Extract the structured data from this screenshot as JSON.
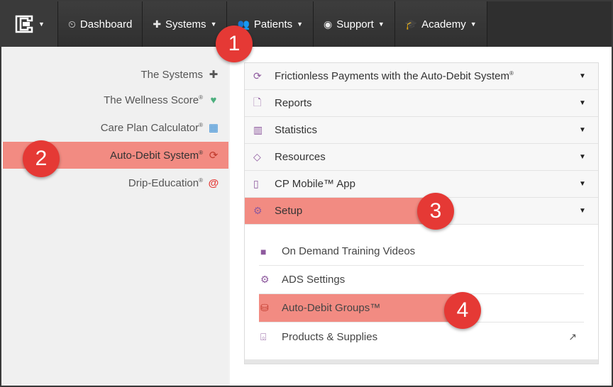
{
  "nav": {
    "logo_icon": "app-logo-icon",
    "items": [
      {
        "label": "Dashboard",
        "icon": "dashboard-icon",
        "glyph": "⏲",
        "has_caret": false
      },
      {
        "label": "Systems",
        "icon": "puzzle-icon",
        "glyph": "✚",
        "has_caret": true
      },
      {
        "label": "Patients",
        "icon": "users-icon",
        "glyph": "👥",
        "has_caret": true
      },
      {
        "label": "Support",
        "icon": "lifebuoy-icon",
        "glyph": "◉",
        "has_caret": true
      },
      {
        "label": "Academy",
        "icon": "graduation-cap-icon",
        "glyph": "🎓",
        "has_caret": true
      }
    ]
  },
  "sidebar": {
    "items": [
      {
        "label": "The Systems",
        "reg": "",
        "icon": "puzzle-icon",
        "glyph": "✚",
        "color": "#555555"
      },
      {
        "label": "The Wellness Score",
        "reg": "®",
        "icon": "heartbeat-icon",
        "glyph": "♥",
        "color": "#4caf7d"
      },
      {
        "label": "Care Plan Calculator",
        "reg": "®",
        "icon": "calculator-icon",
        "glyph": "▦",
        "color": "#3b8fd6"
      },
      {
        "label": "Auto-Debit System",
        "reg": "®",
        "icon": "refresh-icon",
        "glyph": "⟳",
        "color": "#c0392b"
      },
      {
        "label": "Drip-Education",
        "reg": "®",
        "icon": "at-icon",
        "glyph": "@",
        "color": "#e53935"
      }
    ]
  },
  "accordion": {
    "rows": [
      {
        "label": "Frictionless Payments with the Auto-Debit System",
        "reg": "®",
        "icon": "refresh-icon",
        "glyph": "⟳"
      },
      {
        "label": "Reports",
        "reg": "",
        "icon": "file-icon",
        "glyph": "🗋"
      },
      {
        "label": "Statistics",
        "reg": "",
        "icon": "bar-chart-icon",
        "glyph": "▥"
      },
      {
        "label": "Resources",
        "reg": "",
        "icon": "diamond-icon",
        "glyph": "◇"
      },
      {
        "label": "CP Mobile™ App",
        "reg": "",
        "icon": "mobile-icon",
        "glyph": "▯"
      },
      {
        "label": "Setup",
        "reg": "",
        "icon": "cogs-icon",
        "glyph": "⚙"
      }
    ],
    "setup_items": [
      {
        "label": "On Demand Training Videos",
        "icon": "video-camera-icon",
        "glyph": "■"
      },
      {
        "label": "ADS Settings",
        "icon": "gear-icon",
        "glyph": "⚙"
      },
      {
        "label": "Auto-Debit Groups™",
        "icon": "database-icon",
        "glyph": "⛁"
      },
      {
        "label": "Products & Supplies",
        "icon": "basket-icon",
        "glyph": "⌺",
        "external_icon": "external-link-icon"
      }
    ]
  },
  "callouts": [
    "1",
    "2",
    "3",
    "4"
  ],
  "colors": {
    "highlight": "#f28b82",
    "callout": "#e53935",
    "navbar": "#2f2f2f",
    "accent_icon": "#8e5a9e"
  }
}
